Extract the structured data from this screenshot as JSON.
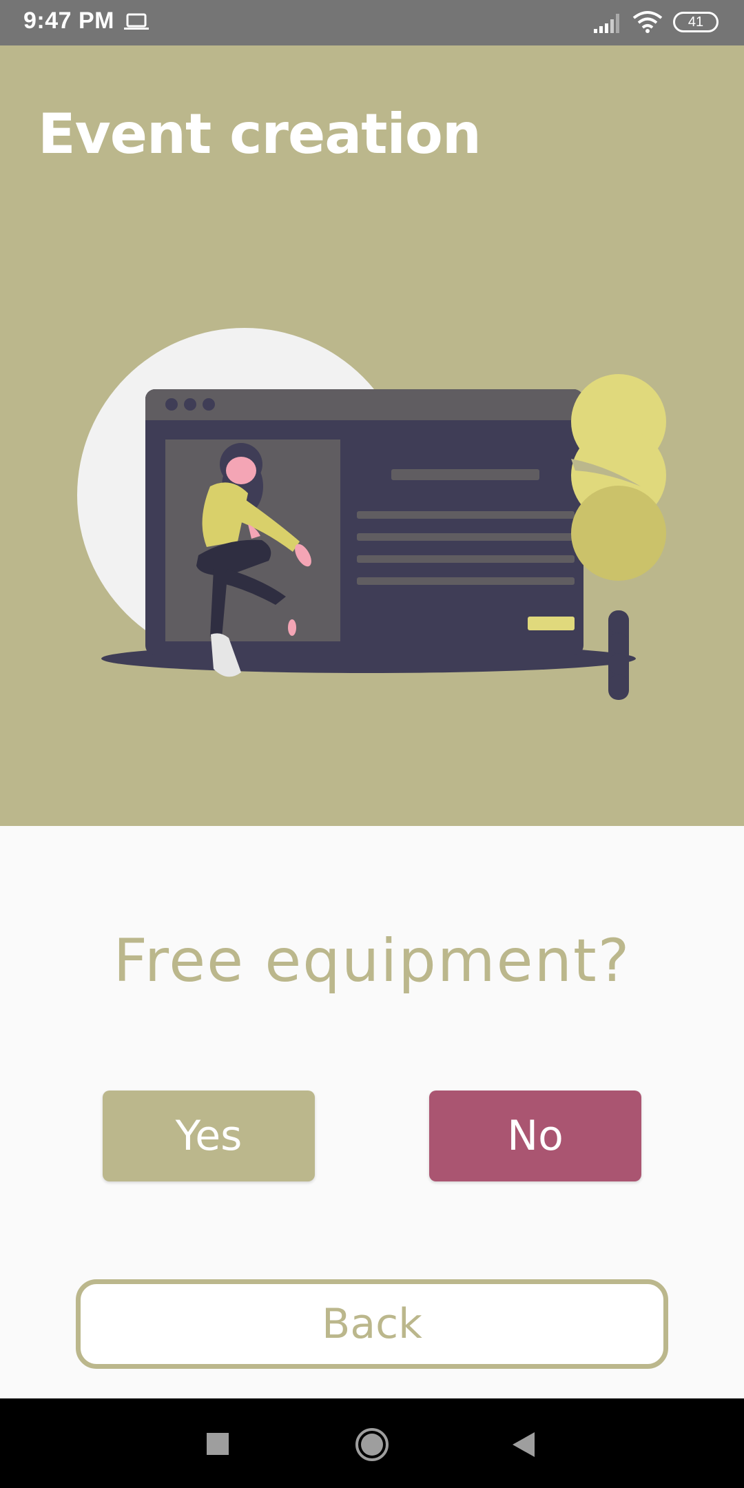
{
  "status_bar": {
    "time": "9:47 PM",
    "battery": "41",
    "icons": [
      "laptop-icon",
      "signal-icon",
      "wifi-icon",
      "battery-icon"
    ]
  },
  "header": {
    "title": "Event creation"
  },
  "content": {
    "question": "Free equipment?",
    "yes_label": "Yes",
    "no_label": "No",
    "back_label": "Back"
  },
  "nav_bar": {
    "icons": [
      "recents-icon",
      "home-icon",
      "back-icon"
    ]
  },
  "colors": {
    "accent": "#bbb78c",
    "no_button": "#aa5571",
    "status_bar": "#757575",
    "background": "#fafafa"
  }
}
